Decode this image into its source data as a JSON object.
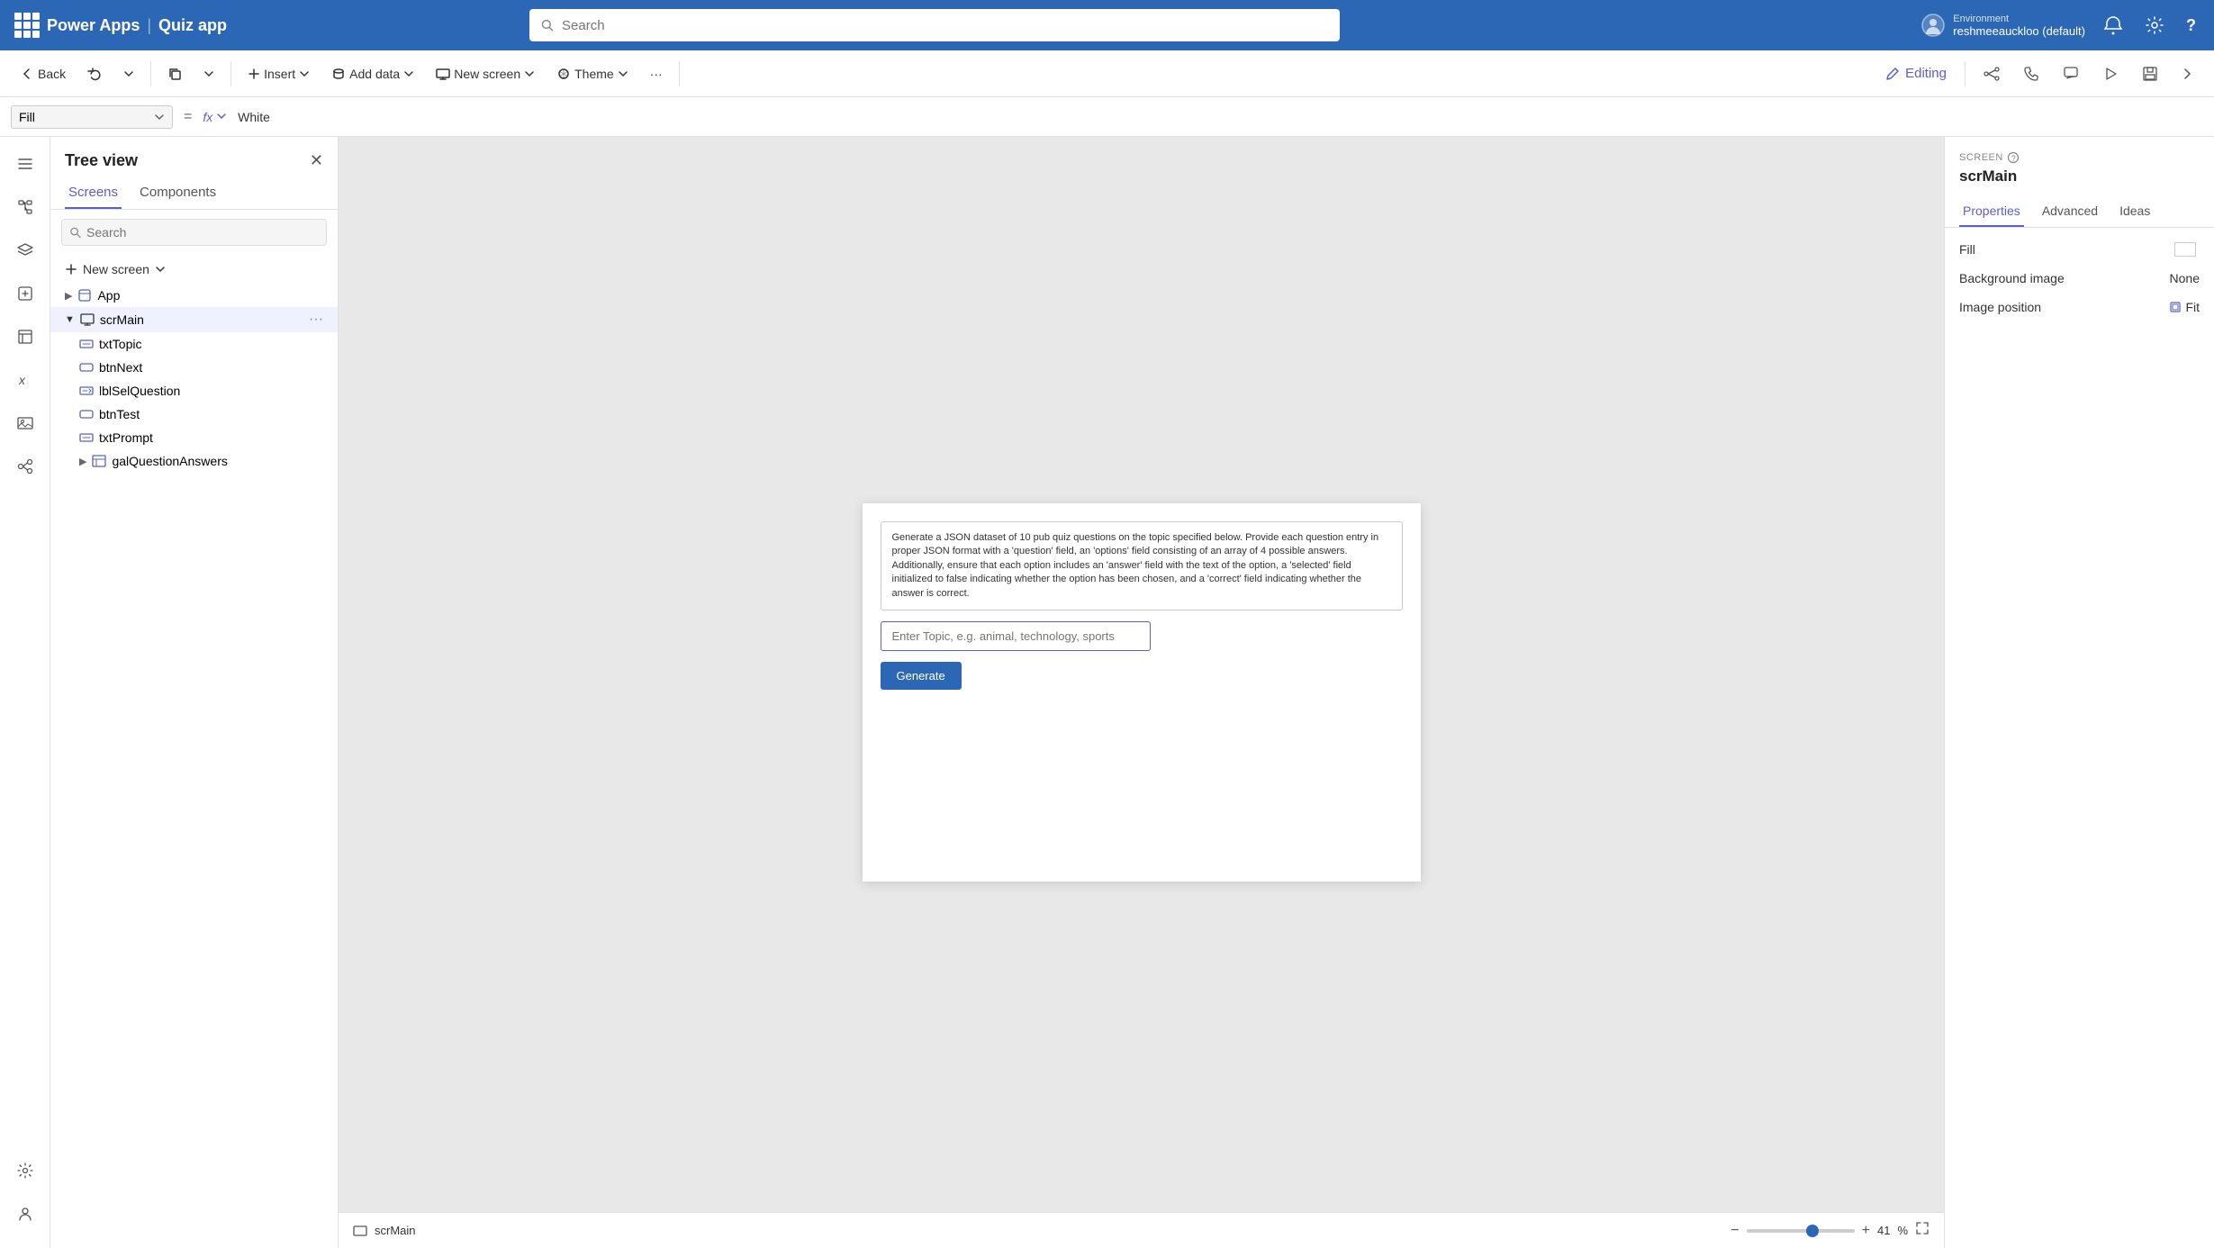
{
  "app": {
    "product_name": "Power Apps",
    "separator": "|",
    "app_name": "Quiz app"
  },
  "topnav": {
    "search_placeholder": "Search",
    "environment_label": "Environment",
    "environment_name": "reshmeeauckloo (default)"
  },
  "toolbar": {
    "back_label": "Back",
    "undo_label": "",
    "insert_label": "Insert",
    "add_data_label": "Add data",
    "new_screen_label": "New screen",
    "theme_label": "Theme",
    "more_label": "···",
    "editing_label": "Editing"
  },
  "formula_bar": {
    "property": "Fill",
    "equals": "=",
    "fx": "fx",
    "value": "White"
  },
  "tree_view": {
    "title": "Tree view",
    "tabs": [
      "Screens",
      "Components"
    ],
    "active_tab": "Screens",
    "search_placeholder": "Search",
    "new_screen_label": "New screen",
    "items": [
      {
        "id": "app",
        "label": "App",
        "level": 0,
        "icon": "📦",
        "expanded": false
      },
      {
        "id": "scrMain",
        "label": "scrMain",
        "level": 0,
        "icon": "🖥",
        "expanded": true,
        "selected": true
      },
      {
        "id": "txtTopic",
        "label": "txtTopic",
        "level": 1,
        "icon": "⬜",
        "expanded": false
      },
      {
        "id": "btnNext",
        "label": "btnNext",
        "level": 1,
        "icon": "⬜",
        "expanded": false
      },
      {
        "id": "lblSelQuestion",
        "label": "lblSelQuestion",
        "level": 1,
        "icon": "✏️",
        "expanded": false
      },
      {
        "id": "btnTest",
        "label": "btnTest",
        "level": 1,
        "icon": "⬜",
        "expanded": false
      },
      {
        "id": "txtPrompt",
        "label": "txtPrompt",
        "level": 1,
        "icon": "⬜",
        "expanded": false
      },
      {
        "id": "galQuestionAnswers",
        "label": "galQuestionAnswers",
        "level": 1,
        "icon": "▦",
        "expanded": false
      }
    ]
  },
  "canvas": {
    "screen_name": "scrMain",
    "prompt_text": "Generate a JSON dataset of 10 pub quiz questions on the topic specified below. Provide each question entry in proper JSON format with a 'question' field, an 'options' field consisting of an array of 4 possible answers. Additionally, ensure that each option includes an 'answer' field with the text of the option, a 'selected' field initialized to false indicating whether the option has been chosen, and a 'correct' field indicating whether the answer is correct.",
    "topic_placeholder": "Enter Topic, e.g. animal, technology, sports",
    "generate_btn_label": "Generate",
    "zoom": "41",
    "zoom_percent": "%"
  },
  "right_panel": {
    "screen_label": "SCREEN",
    "screen_name": "scrMain",
    "tabs": [
      "Properties",
      "Advanced",
      "Ideas"
    ],
    "active_tab": "Properties",
    "fill_label": "Fill",
    "background_image_label": "Background image",
    "background_image_value": "None",
    "image_position_label": "Image position",
    "image_position_value": "Fit"
  }
}
